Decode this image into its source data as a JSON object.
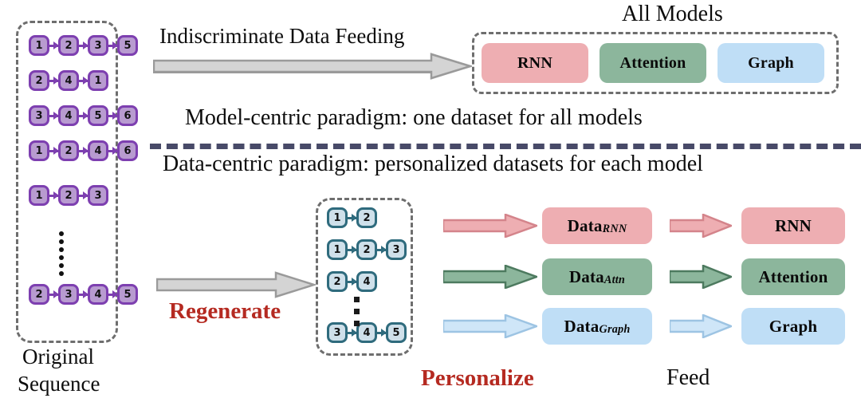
{
  "diagram": {
    "title_all_models": "All Models",
    "top": {
      "feeding_label": "Indiscriminate Data Feeding",
      "paradigm_label": "Model-centric paradigm: one dataset for all models",
      "models": [
        {
          "name": "RNN",
          "color": "#eeaeb2"
        },
        {
          "name": "Attention",
          "color": "#8cb69c"
        },
        {
          "name": "Graph",
          "color": "#bfdef6"
        }
      ]
    },
    "bottom": {
      "paradigm_label": "Data-centric paradigm: personalized datasets for each model",
      "regenerate_label": "Regenerate",
      "personalize_label": "Personalize",
      "feed_label": "Feed",
      "datasets": [
        {
          "name": "Data",
          "subscript": "RNN",
          "color": "#eeaeb2"
        },
        {
          "name": "Data",
          "subscript": "Attn",
          "color": "#8cb69c"
        },
        {
          "name": "Data",
          "subscript": "Graph",
          "color": "#bfdef6"
        }
      ],
      "models": [
        {
          "name": "RNN",
          "color": "#eeaeb2"
        },
        {
          "name": "Attention",
          "color": "#8cb69c"
        },
        {
          "name": "Graph",
          "color": "#bfdef6"
        }
      ]
    },
    "original": {
      "caption_line1": "Original",
      "caption_line2": "Sequence",
      "sequences": [
        [
          1,
          2,
          3,
          5
        ],
        [
          2,
          4,
          1
        ],
        [
          3,
          4,
          5,
          6
        ],
        [
          1,
          2,
          4,
          6
        ],
        [
          1,
          2,
          3
        ],
        [
          2,
          3,
          4,
          5
        ]
      ],
      "ellipsis_after_index": 4,
      "node_fill": "#b89bd0",
      "node_stroke": "#7d3fb0"
    },
    "regenerated": {
      "sequences": [
        [
          1,
          2
        ],
        [
          1,
          2,
          3
        ],
        [
          2,
          4
        ],
        [
          3,
          4,
          5
        ]
      ],
      "ellipsis_after_index": 2,
      "node_fill": "#cfe0ea",
      "node_stroke": "#2f6b7d"
    },
    "colors": {
      "accent_red": "#b52a21",
      "divider": "#484a68",
      "dash_border": "#6e6e6e",
      "gray_arrow_fill": "#d4d4d4",
      "gray_arrow_stroke": "#9a9a9a"
    }
  }
}
